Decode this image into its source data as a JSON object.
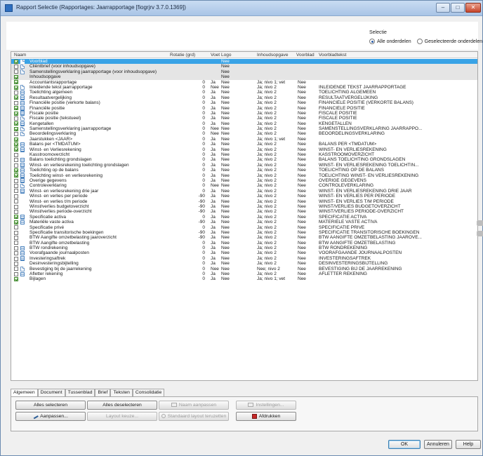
{
  "window": {
    "title": "Rapport Selectie (Rapportages: Jaarrapportage [fiogrjrv 3.7.0.1369])",
    "minimize": "–",
    "maximize": "□",
    "close": "✕"
  },
  "selection": {
    "label": "Selectie",
    "option_all": "Alle onderdelen",
    "option_selected": "Geselecteerde onderdelen",
    "current": "Alle onderdelen"
  },
  "grid": {
    "columns": {
      "naam": "Naam",
      "rotatie": "Rotatie (grd)",
      "voet": "Voet",
      "logo": "Logo",
      "inhoud": "Inhoudsopgave",
      "voorblad": "Voorblad",
      "voorbladtekst": "Voorbladtekst"
    },
    "rows": [
      {
        "checked": true,
        "icon": "doc",
        "name": "Voorblad",
        "rot": "",
        "voet": "",
        "logo": "Nee",
        "inh": "",
        "voorblad": "",
        "vbt": "",
        "state": "selected"
      },
      {
        "checked": false,
        "icon": "doc",
        "name": "Cliëntbrief (voor inhoudsopgave)",
        "rot": "",
        "voet": "",
        "logo": "Nee",
        "inh": "",
        "voorblad": "",
        "vbt": "",
        "state": "grey"
      },
      {
        "checked": false,
        "icon": "doc",
        "name": "Samenstellingsverklaring jaarrapportage (voor inhoudsopgave)",
        "rot": "",
        "voet": "",
        "logo": "Nee",
        "inh": "",
        "voorblad": "",
        "vbt": "",
        "state": "grey"
      },
      {
        "checked": true,
        "icon": "none",
        "name": "Inhoudsopgave",
        "rot": "",
        "voet": "",
        "logo": "Nee",
        "inh": "",
        "voorblad": "",
        "vbt": "",
        "state": "grey"
      },
      {
        "checked": true,
        "icon": "none",
        "name": "Accountantsrapportage",
        "rot": "0",
        "voet": "Ja",
        "logo": "Nee",
        "inh": "Ja; nivo 1; vet",
        "voorblad": "Nee",
        "vbt": "",
        "state": ""
      },
      {
        "checked": true,
        "icon": "doc",
        "name": "Inleidende tekst jaarrapportage",
        "rot": "0",
        "voet": "Nee",
        "logo": "Nee",
        "inh": "Ja; nivo 2",
        "voorblad": "Nee",
        "vbt": "INLEIDENDE TEKST JAARRAPPORTAGE",
        "state": ""
      },
      {
        "checked": false,
        "icon": "list",
        "name": "Toelichting algemeen",
        "rot": "0",
        "voet": "Ja",
        "logo": "Nee",
        "inh": "Ja; nivo 2",
        "voorblad": "Nee",
        "vbt": "TOELICHTING ALGEMEEN",
        "state": ""
      },
      {
        "checked": true,
        "icon": "list",
        "name": "Resultaatvergelijking",
        "rot": "0",
        "voet": "Ja",
        "logo": "Nee",
        "inh": "Ja; nivo 2",
        "voorblad": "Nee",
        "vbt": "RESULTAATVERGELIJKING",
        "state": ""
      },
      {
        "checked": false,
        "icon": "list",
        "name": "Financiële positie (verkorte balans)",
        "rot": "0",
        "voet": "Ja",
        "logo": "Nee",
        "inh": "Ja; nivo 2",
        "voorblad": "Nee",
        "vbt": "FINANCIËLE POSITIE (VERKORTE BALANS)",
        "state": ""
      },
      {
        "checked": true,
        "icon": "list",
        "name": "Financiële positie",
        "rot": "0",
        "voet": "Ja",
        "logo": "Nee",
        "inh": "Ja; nivo 2",
        "voorblad": "Nee",
        "vbt": "FINANCIËLE POSITIE",
        "state": ""
      },
      {
        "checked": true,
        "icon": "list",
        "name": "Fiscale positie",
        "rot": "0",
        "voet": "Ja",
        "logo": "Nee",
        "inh": "Ja; nivo 2",
        "voorblad": "Nee",
        "vbt": "FISCALE POSITIE",
        "state": ""
      },
      {
        "checked": false,
        "icon": "doc",
        "name": "Fiscale positie (tekstueel)",
        "rot": "0",
        "voet": "Ja",
        "logo": "Nee",
        "inh": "Ja; nivo 2",
        "voorblad": "Nee",
        "vbt": "FISCALE POSITIE",
        "state": ""
      },
      {
        "checked": true,
        "icon": "list",
        "name": "Kengetallen",
        "rot": "0",
        "voet": "Ja",
        "logo": "Nee",
        "inh": "Ja; nivo 2",
        "voorblad": "Nee",
        "vbt": "KENGETALLEN",
        "state": ""
      },
      {
        "checked": true,
        "icon": "doc",
        "name": "Samenstellingsverklaring jaarrapportage",
        "rot": "0",
        "voet": "Nee",
        "logo": "Nee",
        "inh": "Ja; nivo 2",
        "voorblad": "Nee",
        "vbt": "SAMENSTELLINGSVERKLARING JAARRAPPO...",
        "state": ""
      },
      {
        "checked": false,
        "icon": "doc",
        "name": "Beoordelingsverklaring",
        "rot": "0",
        "voet": "Nee",
        "logo": "Nee",
        "inh": "Ja; nivo 2",
        "voorblad": "Nee",
        "vbt": "BEOORDELINGSVERKLARING",
        "state": ""
      },
      {
        "checked": true,
        "icon": "none",
        "name": "Jaarstukken <JAAR>",
        "rot": "0",
        "voet": "Ja",
        "logo": "Nee",
        "inh": "Ja; nivo 1; vet",
        "voorblad": "Nee",
        "vbt": "",
        "state": ""
      },
      {
        "checked": true,
        "icon": "list",
        "name": "Balans per <TMDATUM>",
        "rot": "0",
        "voet": "Ja",
        "logo": "Nee",
        "inh": "Ja; nivo 2",
        "voorblad": "Nee",
        "vbt": "BALANS PER <TMDATUM>",
        "state": ""
      },
      {
        "checked": true,
        "icon": "list",
        "name": "Winst- en Verliesrekening",
        "rot": "0",
        "voet": "Ja",
        "logo": "Nee",
        "inh": "Ja; nivo 2",
        "voorblad": "Nee",
        "vbt": "WINST- EN VERLIESREKENING",
        "state": ""
      },
      {
        "checked": false,
        "icon": "none",
        "name": "Kasstroomoverzicht",
        "rot": "0",
        "voet": "Ja",
        "logo": "Nee",
        "inh": "Ja; nivo 2",
        "voorblad": "Nee",
        "vbt": "KASSTROOMOVERZICHT",
        "state": ""
      },
      {
        "checked": false,
        "icon": "list",
        "name": "Balans toelichting grondslagen",
        "rot": "0",
        "voet": "Ja",
        "logo": "Nee",
        "inh": "Ja; nivo 2",
        "voorblad": "Nee",
        "vbt": "BALANS TOELICHTING GRONDSLAGEN",
        "state": ""
      },
      {
        "checked": false,
        "icon": "list",
        "name": "Winst- en verliesrekening toelichting grondslagen",
        "rot": "0",
        "voet": "Ja",
        "logo": "Nee",
        "inh": "Ja; nivo 2",
        "voorblad": "Nee",
        "vbt": "WINST- EN VERLIESREKENING TOELICHTIN...",
        "state": ""
      },
      {
        "checked": true,
        "icon": "list",
        "name": "Toelichting op de balans",
        "rot": "0",
        "voet": "Ja",
        "logo": "Nee",
        "inh": "Ja; nivo 2",
        "voorblad": "Nee",
        "vbt": "TOELICHTING OP DE BALANS",
        "state": ""
      },
      {
        "checked": true,
        "icon": "list",
        "name": "Toelichting winst- en verliesrekening",
        "rot": "0",
        "voet": "Ja",
        "logo": "Nee",
        "inh": "Ja; nivo 2",
        "voorblad": "Nee",
        "vbt": "TOELICHTING WINST- EN VERLIESREKENING",
        "state": ""
      },
      {
        "checked": false,
        "icon": "list",
        "name": "Overige gegevens",
        "rot": "0",
        "voet": "Ja",
        "logo": "Nee",
        "inh": "Ja; nivo 2",
        "voorblad": "Nee",
        "vbt": "OVERIGE GEGEVENS",
        "state": ""
      },
      {
        "checked": false,
        "icon": "doc",
        "name": "Controleverklaring",
        "rot": "0",
        "voet": "Nee",
        "logo": "Nee",
        "inh": "Ja; nivo 2",
        "voorblad": "Nee",
        "vbt": "CONTROLEVERKLARING",
        "state": ""
      },
      {
        "checked": false,
        "icon": "list",
        "name": "Winst- en verliesrekening drie jaar",
        "rot": "0",
        "voet": "Ja",
        "logo": "Nee",
        "inh": "Ja; nivo 2",
        "voorblad": "Nee",
        "vbt": "WINST- EN VERLIESREKENING DRIE JAAR",
        "state": ""
      },
      {
        "checked": false,
        "icon": "none",
        "name": "Winst- en verlies per periode",
        "rot": "-90",
        "voet": "Ja",
        "logo": "Nee",
        "inh": "Ja; nivo 2",
        "voorblad": "Nee",
        "vbt": "WINST- EN VERLIES PER PERIODE",
        "state": ""
      },
      {
        "checked": false,
        "icon": "none",
        "name": "Winst- en verlies t/m periode",
        "rot": "-90",
        "voet": "Ja",
        "logo": "Nee",
        "inh": "Ja; nivo 2",
        "voorblad": "Nee",
        "vbt": "WINST- EN VERLIES T/M PERIODE",
        "state": ""
      },
      {
        "checked": false,
        "icon": "none",
        "name": "Winst/verlies budgetoverzicht",
        "rot": "-90",
        "voet": "Ja",
        "logo": "Nee",
        "inh": "Ja; nivo 2",
        "voorblad": "Nee",
        "vbt": "WINST/VERLIES BUDGETOVERZICHT",
        "state": ""
      },
      {
        "checked": false,
        "icon": "none",
        "name": "Winst/verlies periode-overzicht",
        "rot": "-90",
        "voet": "Ja",
        "logo": "Nee",
        "inh": "Ja; nivo 2",
        "voorblad": "Nee",
        "vbt": "WINST/VERLIES PERIODE-OVERZICHT",
        "state": ""
      },
      {
        "checked": true,
        "icon": "list",
        "name": "Specificatie activa",
        "rot": "0",
        "voet": "Ja",
        "logo": "Nee",
        "inh": "Ja; nivo 2",
        "voorblad": "Nee",
        "vbt": "SPECIFICATIE ACTIVA",
        "state": ""
      },
      {
        "checked": true,
        "icon": "list",
        "name": "Materiële vaste activa",
        "rot": "-90",
        "voet": "Ja",
        "logo": "Nee",
        "inh": "Ja; nivo 2",
        "voorblad": "Nee",
        "vbt": "MATERIËLE VASTE ACTIVA",
        "state": ""
      },
      {
        "checked": false,
        "icon": "none",
        "name": "Specificatie privé",
        "rot": "0",
        "voet": "Ja",
        "logo": "Nee",
        "inh": "Ja; nivo 2",
        "voorblad": "Nee",
        "vbt": "SPECIFICATIE PRIVÉ",
        "state": ""
      },
      {
        "checked": false,
        "icon": "none",
        "name": "Specificatie transitorische boekingen",
        "rot": "-90",
        "voet": "Ja",
        "logo": "Nee",
        "inh": "Ja; nivo 2",
        "voorblad": "Nee",
        "vbt": "SPECIFICATIE TRANSITORISCHE BOEKINGEN",
        "state": ""
      },
      {
        "checked": false,
        "icon": "none",
        "name": "BTW Aangifte omzetbelasting jaaroverzicht",
        "rot": "-90",
        "voet": "Ja",
        "logo": "Nee",
        "inh": "Ja; nivo 2",
        "voorblad": "Nee",
        "vbt": "BTW AANGIFTE OMZETBELASTING JAAROVE...",
        "state": ""
      },
      {
        "checked": false,
        "icon": "none",
        "name": "BTW Aangifte omzetbelasting",
        "rot": "0",
        "voet": "Ja",
        "logo": "Nee",
        "inh": "Ja; nivo 2",
        "voorblad": "Nee",
        "vbt": "BTW AANGIFTE OMZETBELASTING",
        "state": ""
      },
      {
        "checked": false,
        "icon": "list",
        "name": "BTW rondrekening",
        "rot": "0",
        "voet": "Ja",
        "logo": "Nee",
        "inh": "Ja; nivo 2",
        "voorblad": "Nee",
        "vbt": "BTW RONDREKENING",
        "state": ""
      },
      {
        "checked": false,
        "icon": "list",
        "name": "Voorafgaande journaalposten",
        "rot": "0",
        "voet": "Ja",
        "logo": "Nee",
        "inh": "Ja; nivo 2",
        "voorblad": "Nee",
        "vbt": "VOORAFGAANDE JOURNAALPOSTEN",
        "state": ""
      },
      {
        "checked": false,
        "icon": "list",
        "name": "Investeringsaftrek",
        "rot": "0",
        "voet": "Ja",
        "logo": "Nee",
        "inh": "Ja; nivo 2",
        "voorblad": "Nee",
        "vbt": "INVESTERINGSAFTREK",
        "state": ""
      },
      {
        "checked": false,
        "icon": "none",
        "name": "Desinvesteringsbijtelling",
        "rot": "0",
        "voet": "Ja",
        "logo": "Nee",
        "inh": "Ja; nivo 2",
        "voorblad": "Nee",
        "vbt": "DESINVESTERINGSBIJTELLING",
        "state": ""
      },
      {
        "checked": false,
        "icon": "doc",
        "name": "Bevestiging bij de jaarrekening",
        "rot": "0",
        "voet": "Nee",
        "logo": "Nee",
        "inh": "Nee; nivo 2",
        "voorblad": "Nee",
        "vbt": "BEVESTIGING BIJ DE JAARREKENING",
        "state": ""
      },
      {
        "checked": false,
        "icon": "list",
        "name": "Afletter rekening",
        "rot": "0",
        "voet": "Ja",
        "logo": "Nee",
        "inh": "Ja; nivo 2",
        "voorblad": "Nee",
        "vbt": "AFLETTER REKENING",
        "state": ""
      },
      {
        "checked": true,
        "icon": "none",
        "name": "Bijlagen",
        "rot": "0",
        "voet": "Ja",
        "logo": "Nee",
        "inh": "Ja; nivo 1; vet",
        "voorblad": "Nee",
        "vbt": "",
        "state": ""
      }
    ]
  },
  "tabs": [
    "Algemeen",
    "Document",
    "Tussenblad",
    "Brief",
    "Teksten",
    "Consolidatie"
  ],
  "active_tab": "Algemeen",
  "tab_buttons": {
    "select_all": "Alles selecteren",
    "deselect_all": "Alles deselecteren",
    "rename": "Naam aanpassen",
    "settings": "Instellingen...",
    "customize": "Aanpassen...",
    "layout_choice": "Layout keuze...",
    "restore_layout": "Standaard layout teruzetten",
    "print": "Afdrukken"
  },
  "dialog_buttons": {
    "ok": "OK",
    "cancel": "Annuleren",
    "help": "Help"
  },
  "colors": {
    "selected_row": "#39a3e6",
    "accent": "#2e6fbf"
  }
}
